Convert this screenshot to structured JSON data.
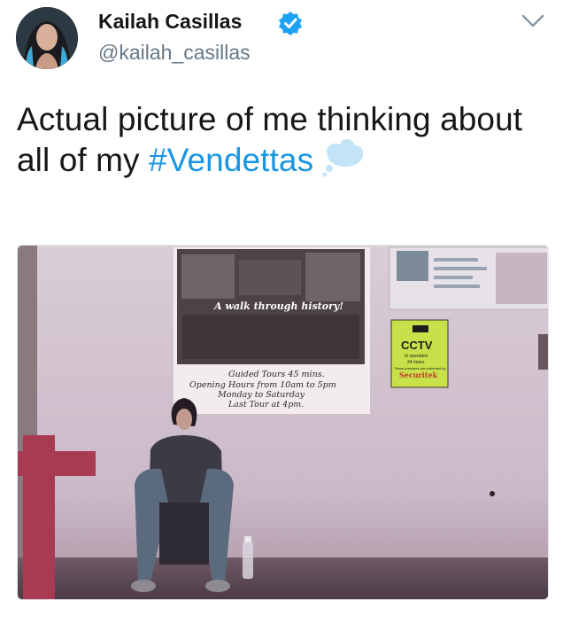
{
  "user": {
    "display_name": "Kailah Casillas",
    "handle": "@kailah_casillas",
    "verified": true,
    "avatar_icon": "avatar-photo"
  },
  "tweet": {
    "text_before": "Actual picture of me thinking about all of my ",
    "hashtag": "#Vendettas",
    "emoji": "thought-balloon-icon"
  },
  "media": {
    "poster_banner": "A walk through history!",
    "poster_lines": [
      "Guided Tours 45 mins.",
      "Opening Hours from 10am to 5pm",
      "Monday to Saturday",
      "Last Tour at 4pm."
    ],
    "cctv_title": "CCTV",
    "cctv_sub": "In operation",
    "cctv_hours": "24 hours",
    "cctv_note": "These premises are protected by",
    "cctv_brand": "Securitek"
  },
  "colors": {
    "accent": "#1b95e0",
    "verified": "#1da1f2",
    "handle": "#657786"
  }
}
